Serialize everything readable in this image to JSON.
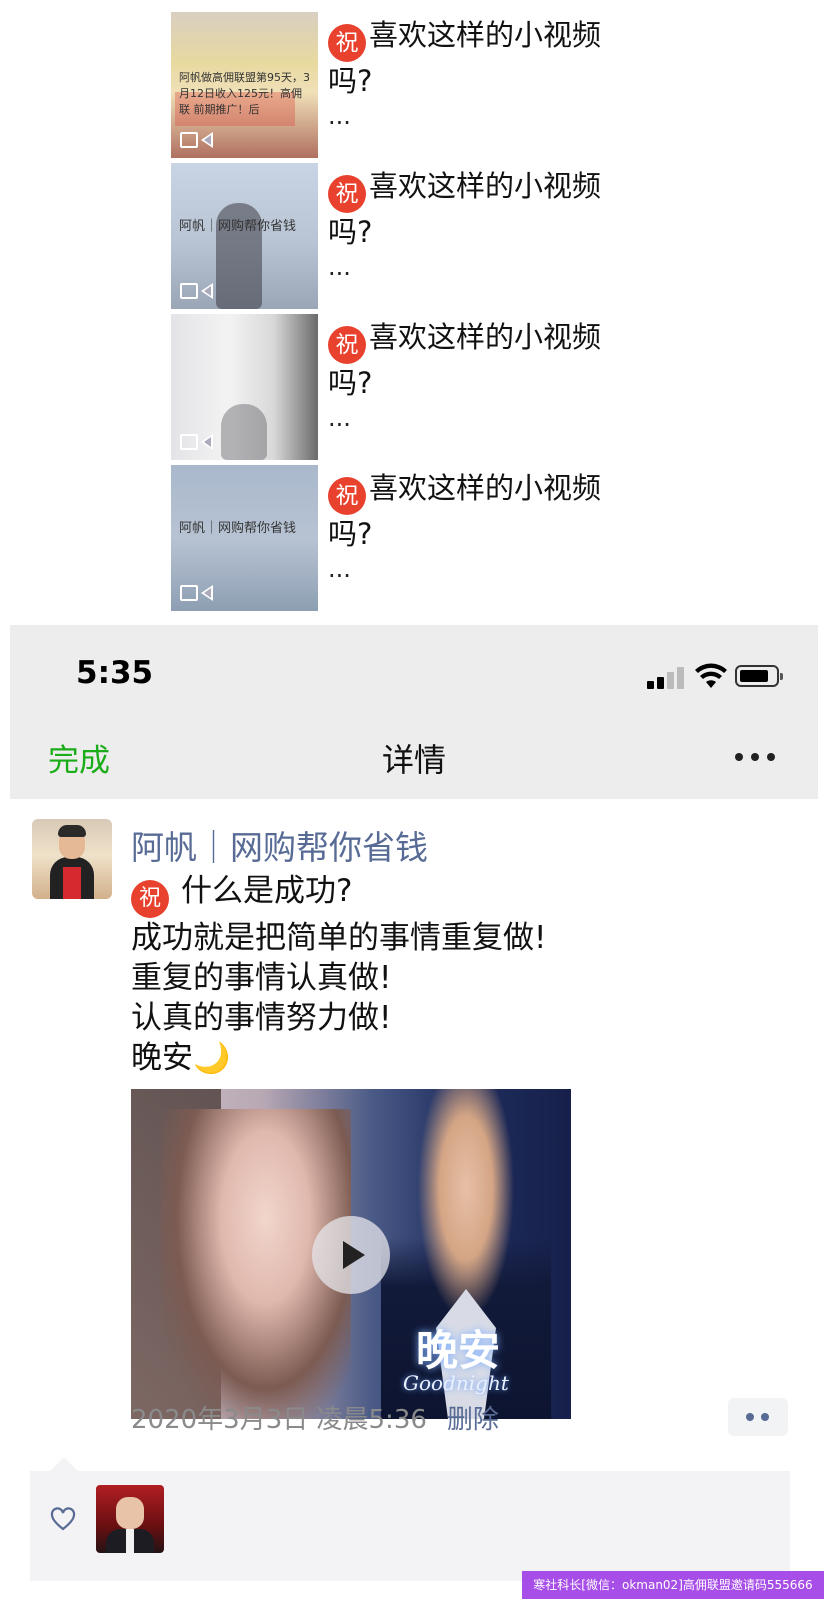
{
  "album": {
    "items": [
      {
        "badge": "祝",
        "text": "喜欢这样的小视频吗?",
        "more": "...",
        "thumb_text": "阿帆做高佣联盟第95天，3月12日收入125元！高佣联 前期推广！后"
      },
      {
        "badge": "祝",
        "text": "喜欢这样的小视频吗?",
        "more": "...",
        "thumb_text": "阿帆｜网购帮你省钱"
      },
      {
        "badge": "祝",
        "text": "喜欢这样的小视频吗?",
        "more": "...",
        "thumb_text": ""
      },
      {
        "badge": "祝",
        "text": "喜欢这样的小视频吗?",
        "more": "...",
        "thumb_text": "阿帆｜网购帮你省钱"
      }
    ]
  },
  "status_bar": {
    "time": "5:35"
  },
  "nav": {
    "done_label": "完成",
    "title": "详情",
    "more_icon": "more-icon"
  },
  "post": {
    "username": "阿帆｜网购帮你省钱",
    "badge": "祝",
    "lines": [
      "什么是成功?",
      "成功就是把简单的事情重复做!",
      "重复的事情认真做!",
      "认真的事情努力做!",
      "晚安"
    ],
    "emoji": "🌙",
    "video": {
      "title_text": "晚安",
      "subtitle_text": "Goodnight"
    },
    "timestamp": "2020年3月3日 凌晨5:36",
    "delete_label": "删除"
  },
  "colors": {
    "accent_green": "#1aad19",
    "link_blue": "#576b95",
    "badge_red": "#e8412e"
  },
  "watermark": "寒社科长[微信：okman02]高佣联盟邀请码555666"
}
